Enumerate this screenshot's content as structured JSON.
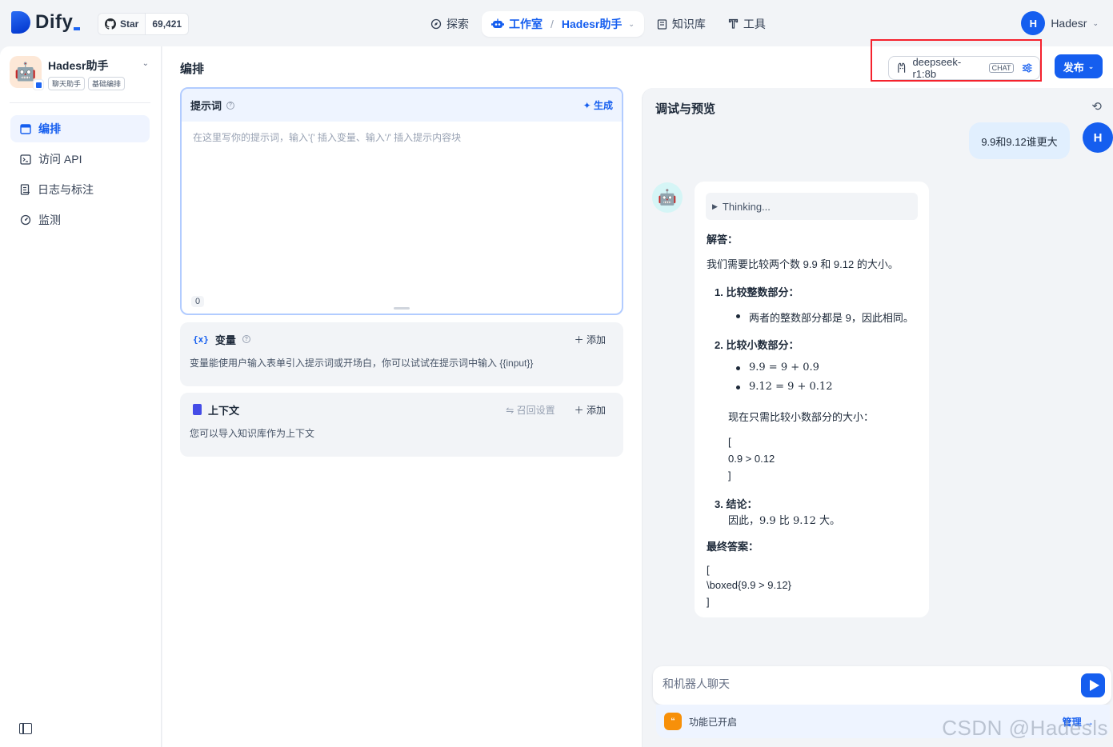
{
  "header": {
    "logo_text": "Dify",
    "github": {
      "star_label": "Star",
      "count": "69,421"
    },
    "nav": [
      {
        "label": "探索",
        "icon": "compass-icon"
      },
      {
        "label": "工作室",
        "icon": "robot-icon",
        "active": true,
        "sub": "Hadesr助手"
      },
      {
        "label": "知识库",
        "icon": "book-icon"
      },
      {
        "label": "工具",
        "icon": "tool-icon"
      }
    ],
    "user": {
      "initial": "H",
      "name": "Hadesr"
    }
  },
  "sidebar": {
    "app_name": "Hadesr助手",
    "tags": [
      "聊天助手",
      "基础编排"
    ],
    "menu": [
      {
        "label": "编排",
        "icon": "layout-icon",
        "active": true
      },
      {
        "label": "访问 API",
        "icon": "terminal-icon"
      },
      {
        "label": "日志与标注",
        "icon": "document-icon"
      },
      {
        "label": "监测",
        "icon": "dashboard-icon"
      }
    ]
  },
  "editor": {
    "title": "编排",
    "model": {
      "name": "deepseek-r1:8b",
      "badge": "CHAT"
    },
    "publish_label": "发布",
    "prompt": {
      "title": "提示词",
      "generate_label": "生成",
      "placeholder": "在这里写你的提示词，输入'{' 插入变量、输入'/' 插入提示内容块",
      "count": "0"
    },
    "variables": {
      "title": "变量",
      "add_label": "添加",
      "desc": "变量能使用户输入表单引入提示词或开场白，你可以试试在提示词中输入 {{input}}"
    },
    "context": {
      "title": "上下文",
      "retrieval_label": "召回设置",
      "add_label": "添加",
      "desc": "您可以导入知识库作为上下文"
    }
  },
  "preview": {
    "title": "调试与预览",
    "user_message": "9.9和9.12谁更大",
    "user_initial": "H",
    "answer": {
      "thinking": "Thinking...",
      "heading": "解答：",
      "intro": "我们需要比较两个数 9.9 和 9.12 的大小。",
      "step1_title": "1. 比较整数部分：",
      "step1_bullet": "两者的整数部分都是 9，因此相同。",
      "step2_title": "2. 比较小数部分：",
      "step2_bullet1": "9.9 = 9 + 0.9",
      "step2_bullet2": "9.12 = 9 + 0.12",
      "step2_note": "现在只需比较小数部分的大小：",
      "step2_bracket_open": "[",
      "step2_expr": "0.9 > 0.12",
      "step2_bracket_close": "]",
      "step3_title": "3. 结论：",
      "step3_text": "因此，9.9 比 9.12 大。",
      "final_title": "最终答案：",
      "final_open": "[",
      "final_expr": "\\boxed{9.9 > 9.12}",
      "final_close": "]"
    },
    "input_placeholder": "和机器人聊天",
    "feature_label": "功能已开启",
    "manage_label": "管理"
  },
  "watermark": "CSDN @Hadesls"
}
